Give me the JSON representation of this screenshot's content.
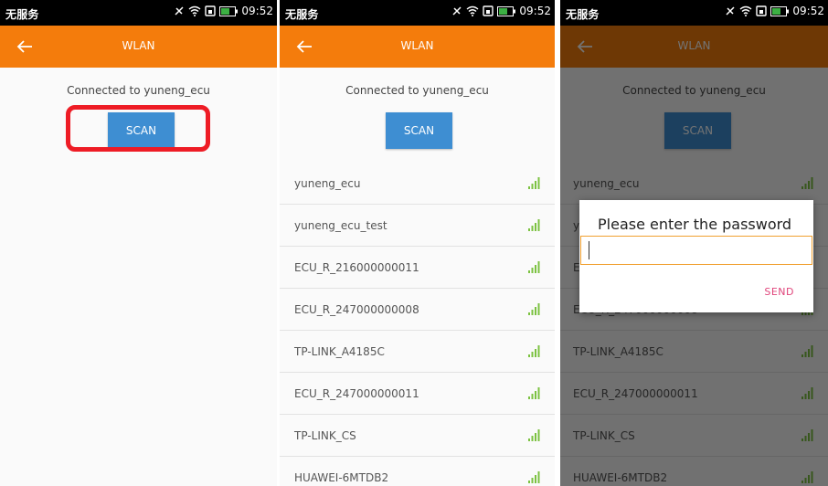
{
  "status": {
    "carrier": "无服务",
    "time": "09:52"
  },
  "appbar": {
    "title": "WLAN"
  },
  "connection": {
    "text": "Connected to yuneng_ecu"
  },
  "scan": {
    "label": "SCAN"
  },
  "networks": [
    "yuneng_ecu",
    "yuneng_ecu_test",
    "ECU_R_216000000011",
    "ECU_R_247000000008",
    "TP-LINK_A4185C",
    "ECU_R_247000000011",
    "TP-LINK_CS",
    "HUAWEI-6MTDB2"
  ],
  "dialog": {
    "title": "Please enter the password",
    "password_value": "",
    "send_label": "SEND"
  },
  "colors": {
    "appbar": "#f47c0c",
    "scan_button": "#3e8ed2",
    "highlight": "#ee1c25",
    "send": "#e0457b",
    "wifi": "#7cc241"
  }
}
